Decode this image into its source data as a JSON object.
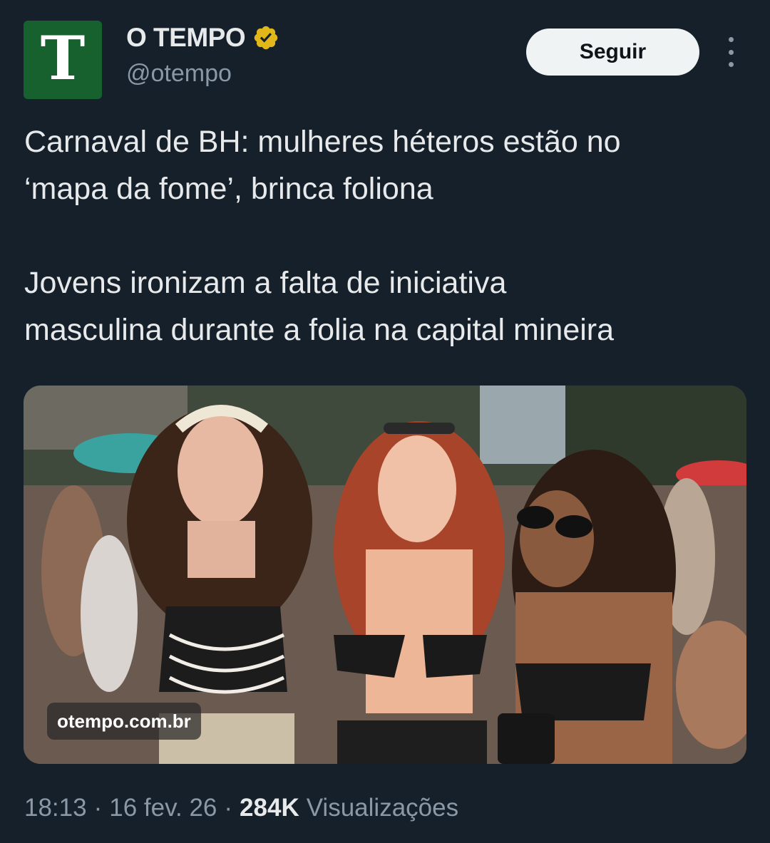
{
  "author": {
    "avatar_letter": "T",
    "name": "O TEMPO",
    "handle": "@otempo",
    "verified_badge": "verified-badge-icon",
    "avatar_color": "#17612f",
    "badge_color": "#e2b719"
  },
  "actions": {
    "follow_label": "Seguir",
    "more_icon": "more-vertical-icon"
  },
  "tweet": {
    "text": "Carnaval de BH: mulheres héteros estão no\n‘mapa da fome’, brinca foliona\n\nJovens ironizam a falta de iniciativa\nmasculina durante a folia na capital mineira"
  },
  "media": {
    "watermark": "otempo.com.br"
  },
  "meta": {
    "time": "18:13",
    "sep1": "·",
    "date": "16 fev. 26",
    "sep2": "·",
    "views_count": "284K",
    "views_label": "Visualizações"
  },
  "colors": {
    "background": "#15202b",
    "text_primary": "#e7e9ea",
    "text_secondary": "#8b98a5",
    "button_bg": "#eff3f4"
  }
}
